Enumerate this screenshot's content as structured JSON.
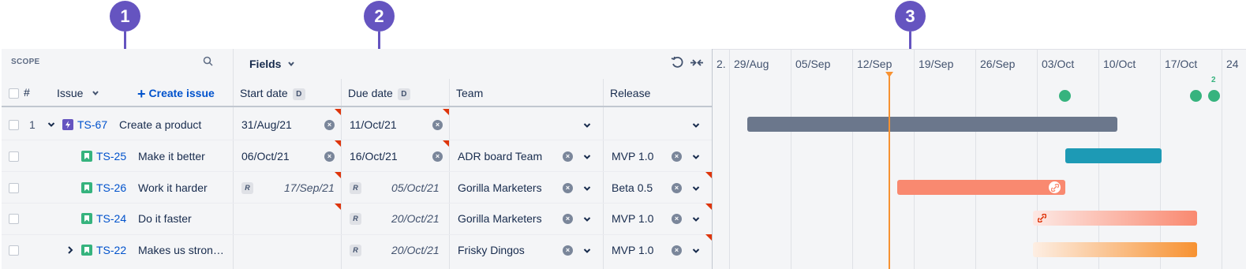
{
  "callouts": [
    "1",
    "2",
    "3"
  ],
  "scope": {
    "label": "SCOPE",
    "hash": "#",
    "issue_header": "Issue",
    "create_issue": "Create issue"
  },
  "fields_button": "Fields",
  "columns": {
    "start_date": "Start date",
    "due_date": "Due date",
    "date_badge": "D",
    "team": "Team",
    "release": "Release"
  },
  "rows": [
    {
      "rank": "1",
      "key": "TS-67",
      "summary": "Create a product",
      "start": "31/Aug/21",
      "due": "11/Oct/21",
      "team": "",
      "release": "",
      "type": "epic"
    },
    {
      "rank": "",
      "key": "TS-25",
      "summary": "Make it better",
      "start": "06/Oct/21",
      "due": "16/Oct/21",
      "team": "ADR board Team",
      "release": "MVP 1.0",
      "type": "story"
    },
    {
      "rank": "",
      "key": "TS-26",
      "summary": "Work it harder",
      "start": "17/Sep/21",
      "due": "05/Oct/21",
      "team": "Gorilla Marketers",
      "release": "Beta 0.5",
      "type": "story"
    },
    {
      "rank": "",
      "key": "TS-24",
      "summary": "Do it faster",
      "start": "",
      "due": "20/Oct/21",
      "team": "Gorilla Marketers",
      "release": "MVP 1.0",
      "type": "story"
    },
    {
      "rank": "",
      "key": "TS-22",
      "summary": "Makes us stron…",
      "start": "",
      "due": "20/Oct/21",
      "team": "Frisky Dingos",
      "release": "MVP 1.0",
      "type": "story"
    }
  ],
  "rollup_badge": "R",
  "timeline": {
    "labels": [
      "2.",
      "29/Aug",
      "05/Sep",
      "12/Sep",
      "19/Sep",
      "26/Sep",
      "03/Oct",
      "10/Oct",
      "17/Oct",
      "24"
    ],
    "milestone_count": "2"
  },
  "colors": {
    "epic_bar": "#6b778c",
    "teal_bar": "#1d9ab5",
    "salmon_bar": "#f98970",
    "today": "#f79232",
    "milestone": "#36b37e",
    "callout": "#6554c0"
  }
}
